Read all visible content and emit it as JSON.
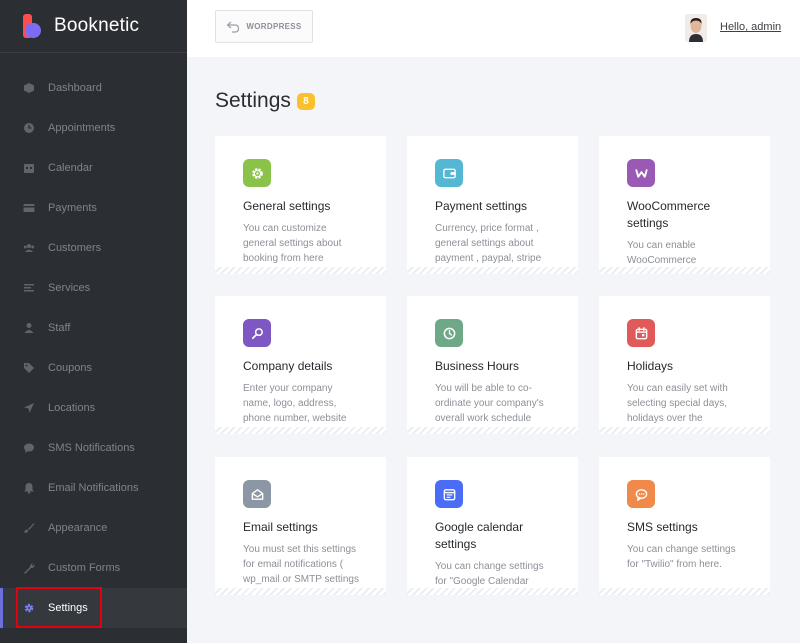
{
  "brand": {
    "name": "Booknetic"
  },
  "sidebar": {
    "items": [
      {
        "label": "Dashboard",
        "icon": "cube-icon"
      },
      {
        "label": "Appointments",
        "icon": "clock-icon"
      },
      {
        "label": "Calendar",
        "icon": "calendar-icon"
      },
      {
        "label": "Payments",
        "icon": "credit-card-icon"
      },
      {
        "label": "Customers",
        "icon": "users-icon"
      },
      {
        "label": "Services",
        "icon": "list-icon"
      },
      {
        "label": "Staff",
        "icon": "user-icon"
      },
      {
        "label": "Coupons",
        "icon": "tag-icon"
      },
      {
        "label": "Locations",
        "icon": "location-arrow-icon"
      },
      {
        "label": "SMS Notifications",
        "icon": "comment-icon"
      },
      {
        "label": "Email Notifications",
        "icon": "bell-icon"
      },
      {
        "label": "Appearance",
        "icon": "brush-icon"
      },
      {
        "label": "Custom Forms",
        "icon": "wrench-icon"
      },
      {
        "label": "Settings",
        "icon": "gear-icon",
        "active": true
      }
    ]
  },
  "header": {
    "wordpress_label": "WORDPRESS",
    "greeting": "Hello, admin"
  },
  "main": {
    "title": "Settings",
    "count": "8",
    "cards": [
      {
        "title": "General settings",
        "desc": [
          "You can customize",
          "general settings about",
          "booking from here"
        ],
        "icon": "gear-icon",
        "color": "#8bc34a"
      },
      {
        "title": "Payment settings",
        "desc": [
          "Currency, price format ,",
          "general settings about",
          "payment , paypal, stripe"
        ],
        "icon": "wallet-icon",
        "color": "#54b7d3"
      },
      {
        "title": "WooCommerce settings",
        "title_lines": [
          "WooCommerce",
          "settings"
        ],
        "desc": [
          "You can enable",
          "WooCommerce"
        ],
        "icon": "woocommerce-icon",
        "color": "#9b59b6"
      },
      {
        "title": "Company details",
        "desc": [
          "Enter your company",
          "name, logo, address,",
          "phone number, website"
        ],
        "icon": "company-icon",
        "color": "#7e57c2"
      },
      {
        "title": "Business Hours",
        "desc": [
          "You will be able to co-",
          "ordinate your company's",
          "overall work schedule"
        ],
        "icon": "clock-icon",
        "color": "#6fa887"
      },
      {
        "title": "Holidays",
        "desc": [
          "You can easily set with",
          "selecting special days,",
          "holidays over the"
        ],
        "icon": "calendar-icon",
        "color": "#e05a5a"
      },
      {
        "title": "Email settings",
        "desc": [
          "You must set this settings",
          "for email notifications (",
          "wp_mail or SMTP settings"
        ],
        "icon": "envelope-icon",
        "color": "#8b97a5"
      },
      {
        "title": "Google calendar settings",
        "title_lines": [
          "Google calendar",
          "settings"
        ],
        "desc": [
          "You can change settings",
          "for \"Google Calendar"
        ],
        "icon": "google-calendar-icon",
        "color": "#4a6cf7"
      },
      {
        "title": "SMS settings",
        "desc": [
          "You can change settings",
          "for \"Twilio\" from here."
        ],
        "icon": "sms-icon",
        "color": "#f08a4b"
      }
    ]
  }
}
